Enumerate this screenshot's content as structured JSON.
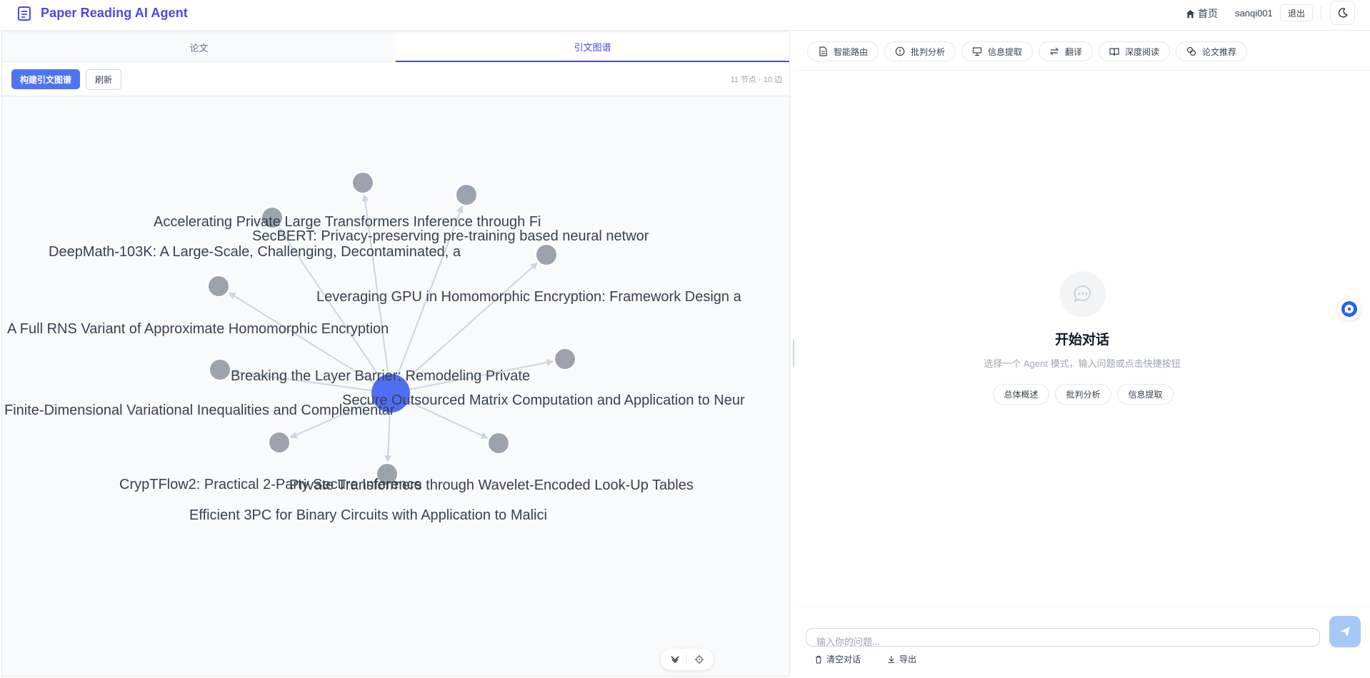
{
  "header": {
    "app_title": "Paper Reading AI Agent",
    "home_label": "首页",
    "username": "sanqi001",
    "logout_label": "退出"
  },
  "left_panel": {
    "tabs": [
      {
        "label": "论文",
        "active": false
      },
      {
        "label": "引文图谱",
        "active": true
      }
    ],
    "toolbar": {
      "build_label": "构建引文图谱",
      "refresh_label": "刷新",
      "stats": "11 节点 · 10 边"
    },
    "graph": {
      "center_node": "A Full RNS Variant of Approximate Homomorphic Encryption",
      "nodes": [
        "Accelerating Private Large Transformers Inference through Fi",
        "SecBERT: Privacy-preserving pre-training based neural networ",
        "DeepMath-103K: A Large-Scale, Challenging, Decontaminated, a",
        "Leveraging GPU in Homomorphic Encryption: Framework Design a",
        "Breaking the Layer Barrier: Remodeling Private",
        "Secure Outsourced Matrix Computation and Application to Neur",
        "Finite-Dimensional Variational Inequalities and Complementar",
        "CrypTFlow2: Practical 2-Party Secure Inference",
        "Private Transformers through Wavelet-Encoded Look-Up Tables",
        "Efficient 3PC for Binary Circuits with Application to Malici"
      ],
      "colors": {
        "center": "#4f6ef2",
        "node": "#9ca3af",
        "edge": "#cbd5e1"
      }
    }
  },
  "right_panel": {
    "modes": [
      "智能路由",
      "批判分析",
      "信息提取",
      "翻译",
      "深度阅读",
      "论文推荐"
    ],
    "empty_state": {
      "title": "开始对话",
      "subtitle": "选择一个 Agent 模式，输入问题或点击快捷按钮",
      "quick_actions": [
        "总体概述",
        "批判分析",
        "信息提取"
      ]
    },
    "input": {
      "placeholder": "输入你的问题..."
    },
    "bottom_actions": {
      "clear_label": "清空对话",
      "export_label": "导出"
    }
  }
}
